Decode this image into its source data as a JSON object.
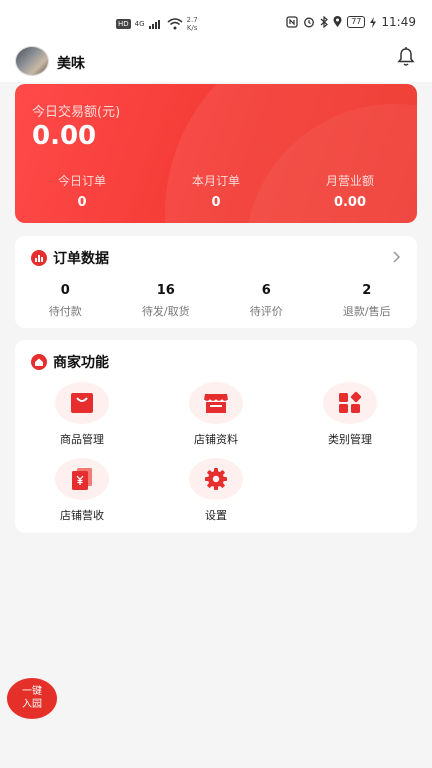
{
  "status_bar": {
    "hd_badge": "HD",
    "network": "4G",
    "speed_value": "2.7",
    "speed_unit": "K/s",
    "battery": "77",
    "time": "11:49"
  },
  "header": {
    "shop_name": "美味"
  },
  "summary": {
    "today_amount_label": "今日交易额(元)",
    "today_amount": "0.00",
    "stats": [
      {
        "label": "今日订单",
        "value": "0"
      },
      {
        "label": "本月订单",
        "value": "0"
      },
      {
        "label": "月营业额",
        "value": "0.00"
      }
    ]
  },
  "order_data": {
    "title": "订单数据",
    "stats": [
      {
        "label": "待付款",
        "value": "0"
      },
      {
        "label": "待发/取货",
        "value": "16"
      },
      {
        "label": "待评价",
        "value": "6"
      },
      {
        "label": "退款/售后",
        "value": "2"
      }
    ]
  },
  "merchant_functions": {
    "title": "商家功能",
    "items": [
      {
        "label": "商品管理",
        "icon": "shopping-bag-icon"
      },
      {
        "label": "店铺资料",
        "icon": "storefront-icon"
      },
      {
        "label": "类别管理",
        "icon": "category-grid-icon"
      },
      {
        "label": "店铺营收",
        "icon": "yuan-receipt-icon"
      },
      {
        "label": "设置",
        "icon": "gear-icon"
      }
    ]
  },
  "float_button": {
    "line1": "一键",
    "line2": "入园"
  },
  "colors": {
    "primary_red": "#e62e2e",
    "icon_bg": "#fdf0ef",
    "page_bg": "#f5f5f5"
  }
}
